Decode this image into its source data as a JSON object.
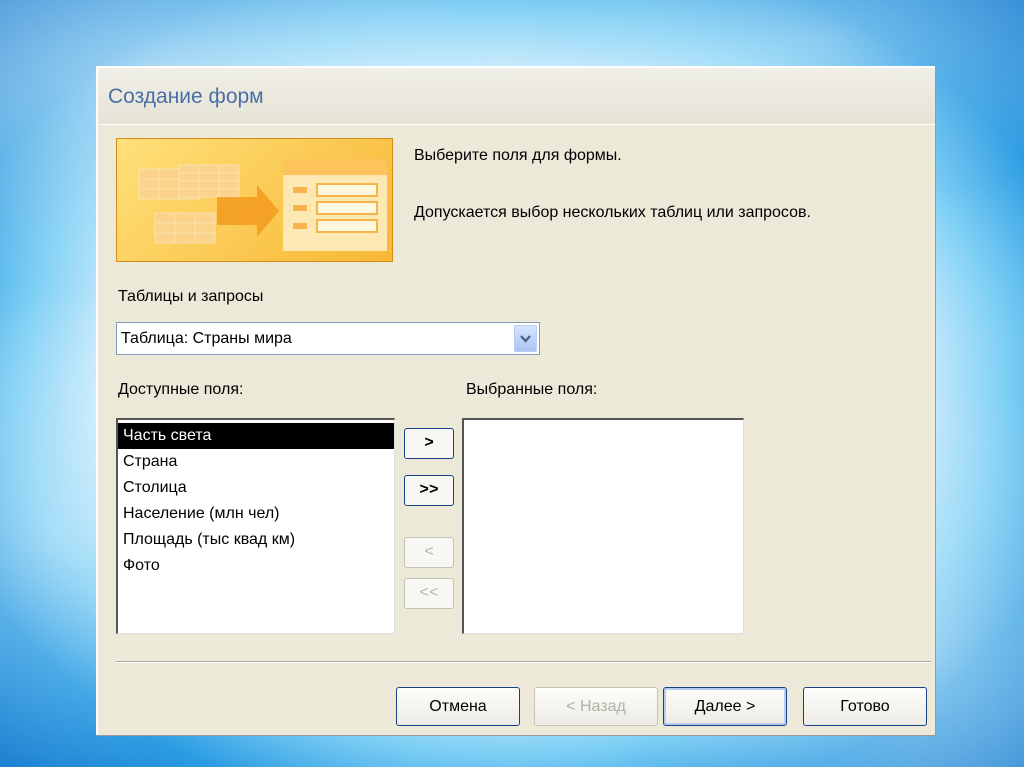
{
  "window": {
    "title": "Создание форм"
  },
  "description": {
    "line1": "Выберите поля для формы.",
    "line2": "Допускается выбор нескольких таблиц или запросов."
  },
  "source": {
    "label": "Таблицы и запросы",
    "selected": "Таблица: Страны мира"
  },
  "available": {
    "label": "Доступные поля:",
    "items": [
      "Часть света",
      "Страна",
      "Столица",
      "Население (млн чел)",
      "Площадь (тыс квад км)",
      "Фото"
    ],
    "selected_index": 0
  },
  "chosen": {
    "label": "Выбранные поля:",
    "items": []
  },
  "move_buttons": {
    "add_one": ">",
    "add_all": ">>",
    "remove_one": "<",
    "remove_all": "<<"
  },
  "footer": {
    "cancel": "Отмена",
    "back": "< Назад",
    "next": "Далее >",
    "finish": "Готово"
  },
  "icons": {
    "illustration": "form-wizard-illustration",
    "dropdown": "chevron-down-icon"
  },
  "colors": {
    "title_text": "#4a6fa5",
    "dialog_bg": "#ece9d8",
    "button_border": "#1c3f8a"
  }
}
